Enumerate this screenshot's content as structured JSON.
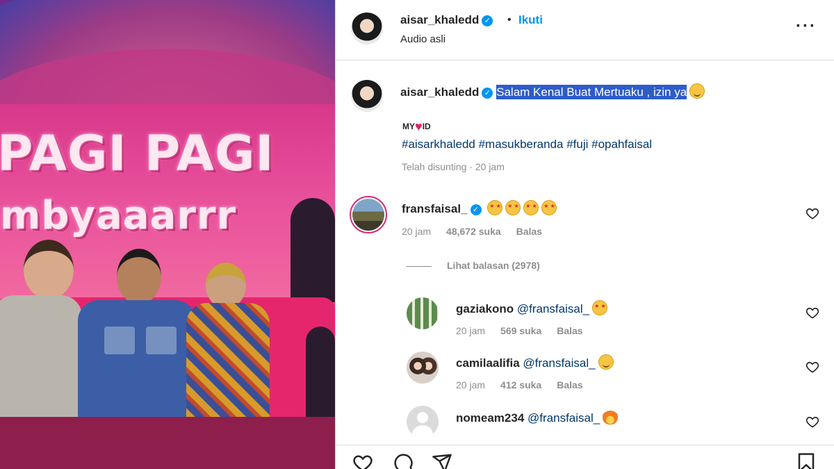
{
  "photo": {
    "sign_line1": "PAGI PAGI",
    "sign_line2": "mbyaaarrr"
  },
  "post": {
    "author": "aisar_khaledd",
    "follow_label": "Ikuti",
    "audio": "Audio asli",
    "separator": "•"
  },
  "caption": {
    "author": "aisar_khaledd",
    "text": "Salam Kenal Buat Mertuaku , izin ya",
    "myid_prefix": "MY",
    "myid_suffix": "ID",
    "hashtags": "#aisarkhaledd #masukberanda #fuji #opahfaisal",
    "edited": "Telah disunting · 20 jam"
  },
  "comments": [
    {
      "user": "fransfaisal_",
      "text": "",
      "time": "20 jam",
      "likes": "48,672 suka",
      "reply": "Balas",
      "view_replies": "Lihat balasan (2978)"
    },
    {
      "user": "gaziakono",
      "text": "@fransfaisal_",
      "time": "20 jam",
      "likes": "569 suka",
      "reply": "Balas"
    },
    {
      "user": "camilaalifia",
      "text": "@fransfaisal_",
      "time": "20 jam",
      "likes": "412 suka",
      "reply": "Balas"
    },
    {
      "user": "nomeam234",
      "text": "@fransfaisal_"
    }
  ],
  "icons": [
    "more-icon",
    "verified-icon",
    "heart-icon",
    "comment-icon",
    "share-icon",
    "bookmark-icon"
  ],
  "colors": {
    "accent": "#0095f6",
    "mention": "#00376b",
    "selection": "#2e5cc8",
    "muted": "#8e8e8e"
  }
}
